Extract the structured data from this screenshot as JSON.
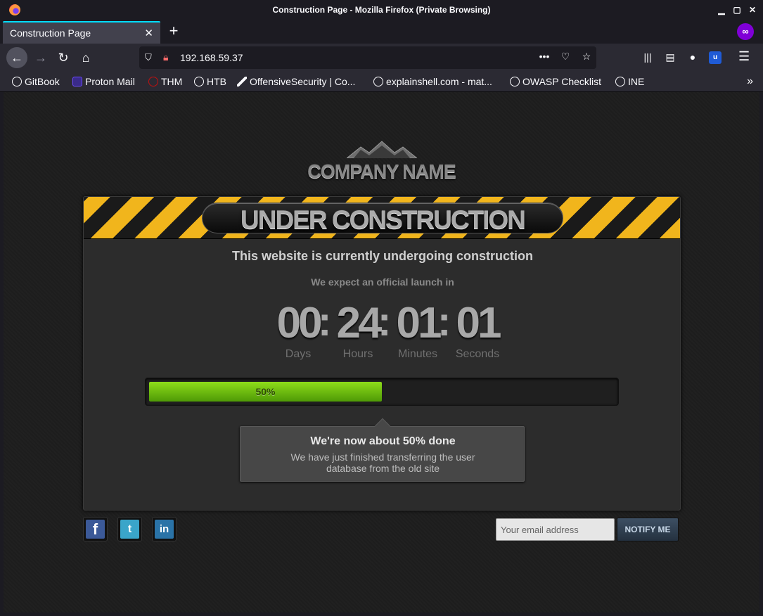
{
  "window": {
    "title": "Construction Page - Mozilla Firefox (Private Browsing)",
    "controls": {
      "minimize": "▁",
      "maximize": "▢",
      "close": "✕"
    }
  },
  "tab": {
    "title": "Construction Page",
    "close": "✕"
  },
  "new_tab_label": "+",
  "nav": {
    "back": "←",
    "forward": "→",
    "reload": "↻",
    "home": "⌂",
    "url": "192.168.59.37"
  },
  "bookmarks": [
    {
      "label": "GitBook",
      "icon": "globe-icon"
    },
    {
      "label": "Proton Mail",
      "icon": "proton-icon"
    },
    {
      "label": "THM",
      "icon": "thm-icon"
    },
    {
      "label": "HTB",
      "icon": "globe-icon"
    },
    {
      "label": "OffensiveSecurity | Co...",
      "icon": "offsec-icon"
    },
    {
      "label": "explainshell.com - mat...",
      "icon": "globe-icon"
    },
    {
      "label": "OWASP Checklist",
      "icon": "globe-icon"
    },
    {
      "label": "INE",
      "icon": "globe-icon"
    }
  ],
  "page": {
    "company": "COMPANY NAME",
    "banner": "UNDER CONSTRUCTION",
    "headline": "This website is currently undergoing construction",
    "subline": "We expect an official launch in",
    "countdown": {
      "days": "00",
      "hours": "24",
      "minutes": "01",
      "seconds": "01",
      "labels": {
        "days": "Days",
        "hours": "Hours",
        "minutes": "Minutes",
        "seconds": "Seconds"
      }
    },
    "progress": {
      "percent": 50,
      "label": "50%"
    },
    "tooltip": {
      "title": "We're now about 50% done",
      "body": "We have just finished transferring the user database from the old site"
    },
    "social": {
      "facebook": "f",
      "twitter": "t",
      "linkedin": "in"
    },
    "email_placeholder": "Your email address",
    "notify_label": "NOTIFY ME"
  },
  "colors": {
    "hazard_yellow": "#f1b51c",
    "progress_green": "#7ccf12",
    "firefox_accent": "#00ddff",
    "private_purple": "#8000d7"
  }
}
